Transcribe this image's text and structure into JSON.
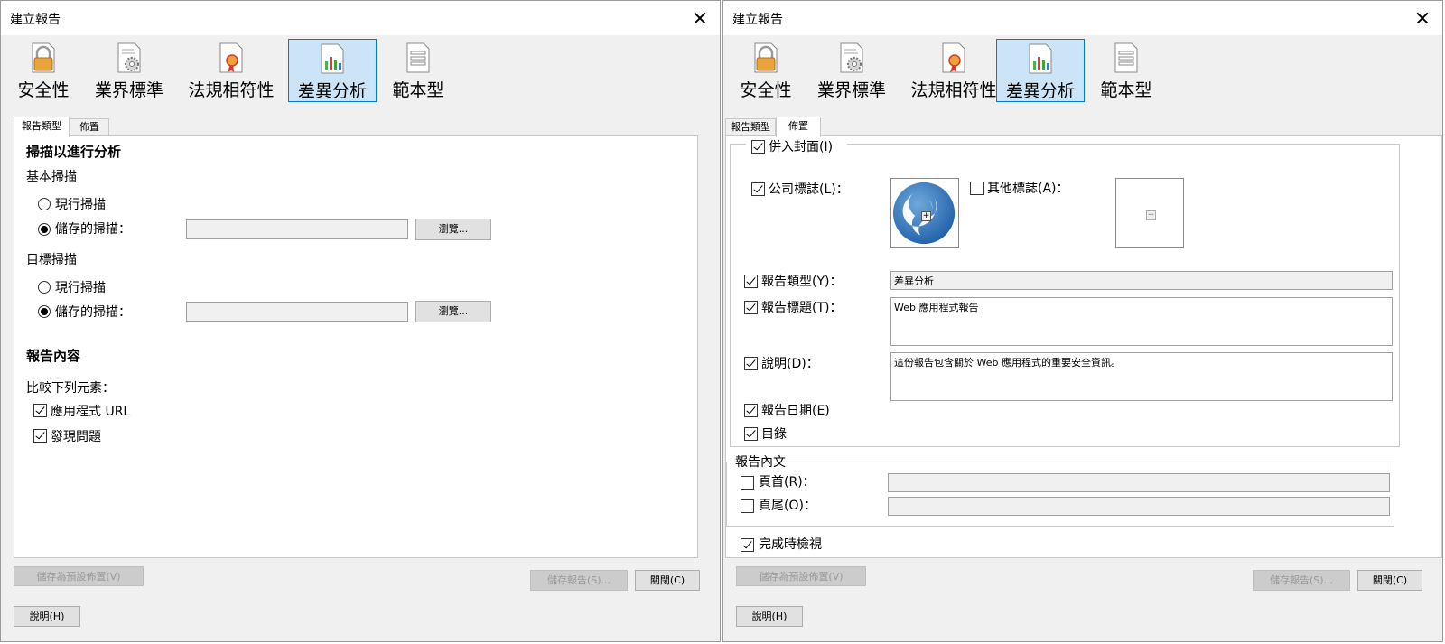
{
  "left": {
    "title": "建立報告",
    "ribbon": [
      "安全性",
      "業界標準",
      "法規相符性",
      "差異分析",
      "範本型"
    ],
    "tabs": [
      "報告類型",
      "佈置"
    ],
    "scan_section": "掃描以進行分析",
    "base_scan": "基本掃描",
    "target_scan": "目標掃描",
    "current_scan": "現行掃描",
    "saved_scan": "儲存的掃描：",
    "browse": "瀏覽...",
    "report_content": "報告內容",
    "compare_elements": "比較下列元素：",
    "app_url": "應用程式 URL",
    "found_issues": "發現問題",
    "save_default": "儲存為預設佈置(V)",
    "save_report": "儲存報告(S)...",
    "close": "關閉(C)",
    "help": "說明(H)"
  },
  "right": {
    "title": "建立報告",
    "ribbon": [
      "安全性",
      "業界標準",
      "法規相符性",
      "差異分析",
      "範本型"
    ],
    "tabs": [
      "報告類型",
      "佈置"
    ],
    "include_cover": "併入封面(I)",
    "company_logo": "公司標誌(L)：",
    "other_logo": "其他標誌(A)：",
    "report_type_label": "報告類型(Y)：",
    "report_type_value": "差異分析",
    "report_title_label": "報告標題(T)：",
    "report_title_value": "Web 應用程式報告",
    "description_label": "說明(D)：",
    "description_value": "這份報告包含關於 Web 應用程式的重要安全資訊。",
    "report_date": "報告日期(E)",
    "toc": "目錄",
    "report_body": "報告內文",
    "header": "頁首(R)：",
    "footer": "頁尾(O)：",
    "view_on_complete": "完成時檢視",
    "save_default": "儲存為預設佈置(V)",
    "save_report": "儲存報告(S)...",
    "close": "關閉(C)",
    "help": "說明(H)"
  },
  "colors": {
    "selected_ribbon": "#cce4f7",
    "selected_border": "#0078d7",
    "logo_blue": "#2f6fb8"
  },
  "icons": [
    "lock-icon",
    "gear-document-icon",
    "ribbon-award-icon",
    "chart-document-icon",
    "template-document-icon",
    "company-logo-icon",
    "add-icon",
    "close-icon"
  ]
}
